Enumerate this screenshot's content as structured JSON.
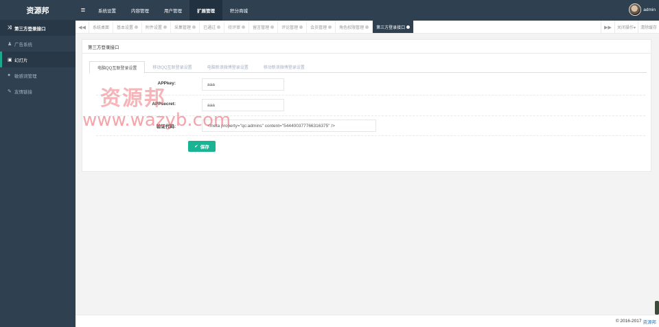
{
  "brand": "资源邦",
  "sidebar": {
    "items": [
      {
        "label": "第三方登录接口",
        "icon": "shuffle-icon"
      },
      {
        "label": "广告系统",
        "icon": "user-icon"
      },
      {
        "label": "幻灯片",
        "icon": "picture-icon"
      },
      {
        "label": "敏感词管理",
        "icon": "drop-icon"
      },
      {
        "label": "友情链接",
        "icon": "link-icon"
      }
    ]
  },
  "topnav": {
    "items": [
      "系统设置",
      "内容管理",
      "用户管理",
      "扩展管理",
      "积分商城"
    ],
    "active_index": 3
  },
  "user": {
    "name": "admin"
  },
  "tabs": {
    "items": [
      "系统桌面",
      "基本设置",
      "附件设置",
      "采集管理",
      "已通过",
      "待评审",
      "留言管理",
      "评论管理",
      "会员管理",
      "角色权限管理",
      "第三方登录接口"
    ],
    "close_op": "关闭操作▾",
    "clear_cache": "清除缓存"
  },
  "card": {
    "title": "第三方登录接口",
    "form_tabs": [
      "电脑QQ互联登录设置",
      "移动QQ互联登录设置",
      "电脑新浪微博登录设置",
      "移动新浪微博登录设置"
    ],
    "fields": {
      "appkey_label": "APPkey:",
      "appkey_value": "aaa",
      "appsecret_label": "APPsecret:",
      "appsecret_value": "aaa",
      "verify_label": "验证代码:",
      "verify_value": "<meta property=\"qc:admins\" content=\"544400377766316375\" />"
    },
    "save_label": "保存"
  },
  "watermark": {
    "line1": "资源邦",
    "line2": "www.wazyb.com"
  },
  "footer": {
    "copyright": "© 2016-2017",
    "link": "资源邦"
  },
  "colors": {
    "sidebar_bg": "#2f4050",
    "accent": "#1ab394",
    "watermark": "#ec5a64"
  }
}
